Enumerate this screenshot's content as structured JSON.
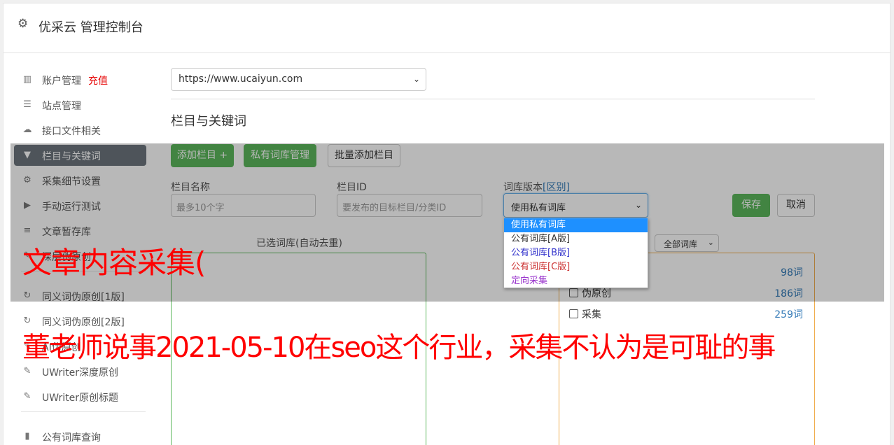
{
  "header": {
    "icon": "gear-icon",
    "title": "优采云 管理控制台"
  },
  "sidebar": {
    "items": [
      {
        "icon": "bar-chart-icon",
        "glyph": "▥",
        "label": "账户管理",
        "badge": "充值"
      },
      {
        "icon": "server-icon",
        "glyph": "☰",
        "label": "站点管理"
      },
      {
        "icon": "cloud-upload-icon",
        "glyph": "☁",
        "label": "接口文件相关"
      },
      {
        "icon": "filter-icon",
        "glyph": "▼",
        "label": "栏目与关键词",
        "active": true
      },
      {
        "icon": "gears-icon",
        "glyph": "⚙",
        "label": "采集细节设置"
      },
      {
        "icon": "play-circle-icon",
        "glyph": "▶",
        "label": "手动运行测试"
      },
      {
        "icon": "database-icon",
        "glyph": "≡",
        "label": "文章暂存库"
      },
      {
        "icon": "edit-icon",
        "glyph": "✎",
        "label": "深层伪原创"
      },
      {
        "icon": "refresh-icon",
        "glyph": "↻",
        "label": "同义词伪原创[1版]"
      },
      {
        "icon": "refresh-icon",
        "glyph": "↻",
        "label": "同义词伪原创[2版]"
      },
      {
        "icon": "edit-icon",
        "glyph": "✎",
        "label": "AI伪原创"
      },
      {
        "icon": "edit-icon",
        "glyph": "✎",
        "label": "UWriter深度原创"
      },
      {
        "icon": "edit-icon",
        "glyph": "✎",
        "label": "UWriter原创标题"
      },
      {
        "icon": "book-icon",
        "glyph": "▮",
        "label": "公有词库查询"
      }
    ]
  },
  "site_select": {
    "value": "https://www.ucaiyun.com"
  },
  "section_title": "栏目与关键词",
  "toolbar": {
    "add_column": "添加栏目 +",
    "private_lib": "私有词库管理",
    "batch_add": "批量添加栏目"
  },
  "form": {
    "name_label": "栏目名称",
    "name_placeholder": "最多10个字",
    "id_label": "栏目ID",
    "id_placeholder": "要发布的目标栏目/分类ID",
    "version_label": "词库版本",
    "version_link": "[区别]",
    "version_value": "使用私有词库",
    "save": "保存",
    "cancel": "取消"
  },
  "dropdown": {
    "options": [
      {
        "label": "使用私有词库",
        "color": "#ffffff",
        "selected": true
      },
      {
        "label": "公有词库[A版]",
        "color": "#333333"
      },
      {
        "label": "公有词库[B版]",
        "color": "#3333cc"
      },
      {
        "label": "公有词库[C版]",
        "color": "#cc3333"
      },
      {
        "label": "定向采集",
        "color": "#9933cc"
      }
    ]
  },
  "selected_libs_title": "已选词库(自动去重)",
  "all_libs_select": "全部词库",
  "libraries": [
    {
      "name": "",
      "count": "98词"
    },
    {
      "name": "伪原创",
      "count": "186词"
    },
    {
      "name": "采集",
      "count": "259词"
    }
  ],
  "captions": {
    "line1": "文章内容采集(",
    "line2": "董老师说事2021-05-10在seo这个行业，采集不认为是可耻的事"
  },
  "colors": {
    "green": "#5cb85c",
    "orange": "#f0ad4e",
    "accent_blue": "#337ab7",
    "caption_red": "#ff0000"
  }
}
